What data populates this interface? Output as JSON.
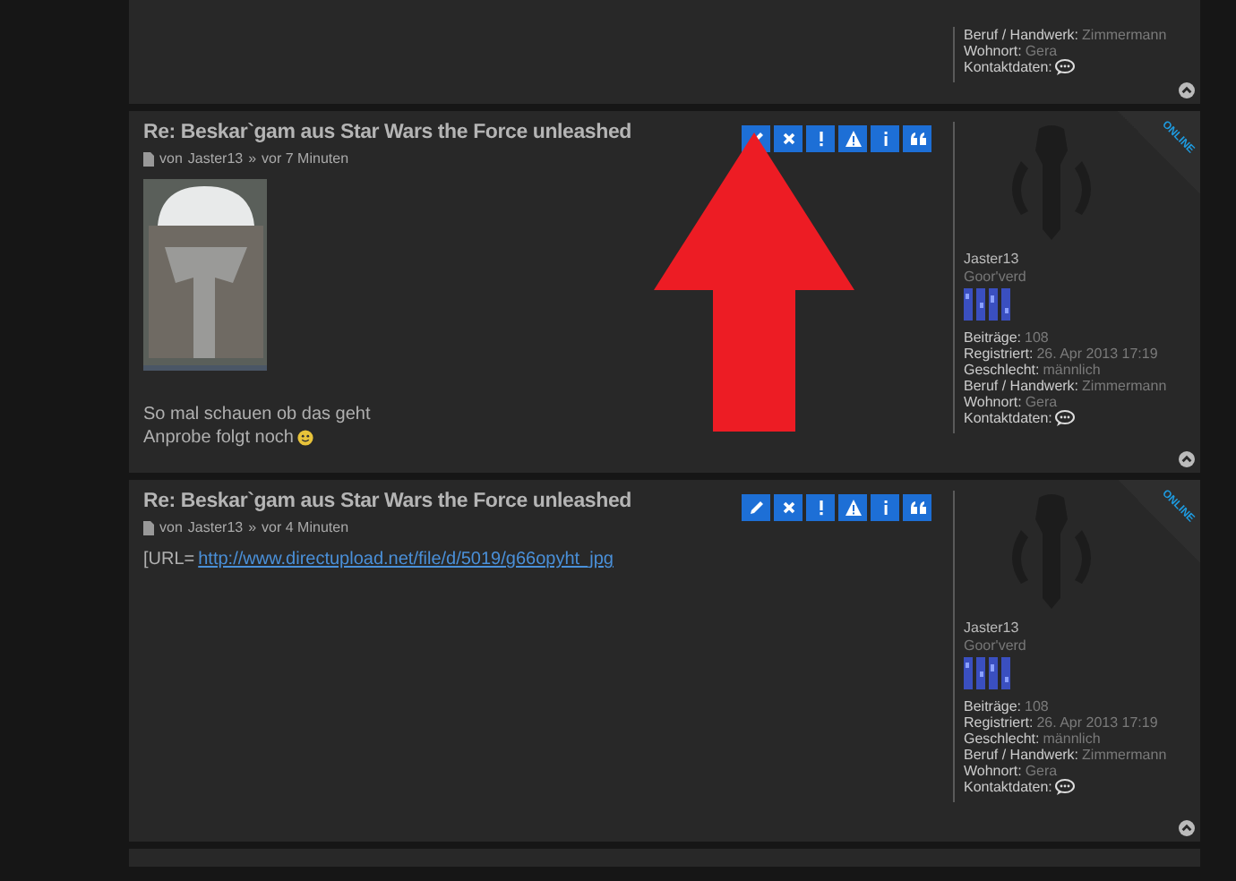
{
  "top_post_fragment": {
    "profile_fields": [
      {
        "kind": "text",
        "label": "Beruf / Handwerk:",
        "value": "Zimmermann"
      },
      {
        "kind": "text",
        "label": "Wohnort:",
        "value": "Gera"
      },
      {
        "kind": "contact",
        "label": "Kontaktdaten:"
      }
    ]
  },
  "posts": [
    {
      "title": "Re: Beskar`gam aus Star Wars the Force unleashed",
      "by_label": "von",
      "author": "Jaster13",
      "separator": "»",
      "time": "vor 7 Minuten",
      "action_buttons": [
        {
          "kind": "edit"
        },
        {
          "kind": "delete"
        },
        {
          "kind": "report"
        },
        {
          "kind": "warn"
        },
        {
          "kind": "info"
        },
        {
          "kind": "quote"
        }
      ],
      "body": [
        {
          "kind": "photo"
        },
        {
          "kind": "spacer"
        },
        {
          "kind": "text",
          "text": "So mal schauen ob das geht"
        },
        {
          "kind": "text",
          "text": "Anprobe folgt noch",
          "smiley": true
        }
      ],
      "profile": {
        "online": "ONLINE",
        "username": "Jaster13",
        "rank": "Goor'verd",
        "fields": [
          {
            "kind": "text",
            "label": "Beiträge:",
            "value": "108"
          },
          {
            "kind": "text",
            "label": "Registriert:",
            "value": "26. Apr 2013 17:19"
          },
          {
            "kind": "text",
            "label": "Geschlecht:",
            "value": "männlich"
          },
          {
            "kind": "text",
            "label": "Beruf / Handwerk:",
            "value": "Zimmermann"
          },
          {
            "kind": "text",
            "label": "Wohnort:",
            "value": "Gera"
          },
          {
            "kind": "contact",
            "label": "Kontaktdaten:"
          }
        ]
      }
    },
    {
      "title": "Re: Beskar`gam aus Star Wars the Force unleashed",
      "by_label": "von",
      "author": "Jaster13",
      "separator": "»",
      "time": "vor 4 Minuten",
      "action_buttons": [
        {
          "kind": "edit"
        },
        {
          "kind": "delete"
        },
        {
          "kind": "report"
        },
        {
          "kind": "warn"
        },
        {
          "kind": "info"
        },
        {
          "kind": "quote"
        }
      ],
      "body": [
        {
          "kind": "link_text",
          "text": "[URL=",
          "link": "http://www.directupload.net/file/d/5019/g66opyht_jpg"
        }
      ],
      "profile": {
        "online": "ONLINE",
        "username": "Jaster13",
        "rank": "Goor'verd",
        "fields": [
          {
            "kind": "text",
            "label": "Beiträge:",
            "value": "108"
          },
          {
            "kind": "text",
            "label": "Registriert:",
            "value": "26. Apr 2013 17:19"
          },
          {
            "kind": "text",
            "label": "Geschlecht:",
            "value": "männlich"
          },
          {
            "kind": "text",
            "label": "Beruf / Handwerk:",
            "value": "Zimmermann"
          },
          {
            "kind": "text",
            "label": "Wohnort:",
            "value": "Gera"
          },
          {
            "kind": "contact",
            "label": "Kontaktdaten:"
          }
        ]
      }
    }
  ],
  "annotation": {
    "kind": "up_arrow"
  }
}
